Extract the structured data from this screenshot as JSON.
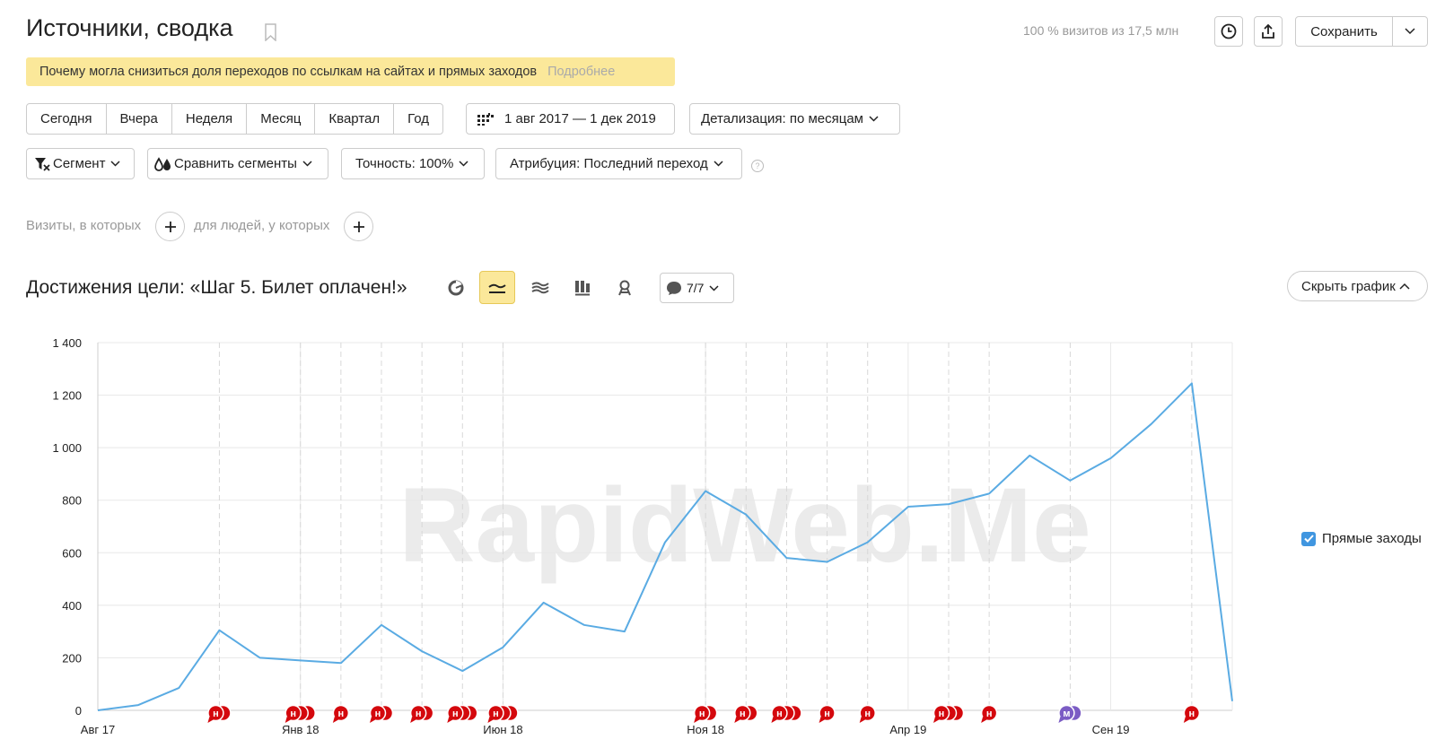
{
  "header": {
    "title": "Источники, сводка",
    "visits_info": "100 % визитов из 17,5 млн",
    "save_label": "Сохранить"
  },
  "notice": {
    "text": "Почему могла снизиться доля переходов по ссылкам на сайтах и прямых заходов",
    "more": "Подробнее"
  },
  "period": {
    "buttons": [
      "Сегодня",
      "Вчера",
      "Неделя",
      "Месяц",
      "Квартал",
      "Год"
    ],
    "date_range": "1 авг 2017 — 1 дек 2019",
    "detail": "Детализация: по месяцам"
  },
  "filters": {
    "segment": "Сегмент",
    "compare": "Сравнить сегменты",
    "accuracy": "Точность: 100%",
    "attribution": "Атрибуция: Последний переход",
    "help": "?",
    "visits_label": "Визиты, в которых",
    "people_label": "для людей, у которых"
  },
  "chart_header": {
    "title": "Достижения цели: «Шаг 5. Билет оплачен!»",
    "notes_count": "7/7",
    "hide_chart": "Скрыть график",
    "selected_type": "line"
  },
  "legend": {
    "item": "Прямые заходы",
    "checked": true,
    "color": "#5aabe3"
  },
  "watermark": "RapidWeb.Me",
  "chart_data": {
    "type": "line",
    "series": [
      {
        "name": "Прямые заходы",
        "color": "#5aabe3",
        "values": [
          0,
          20,
          85,
          305,
          200,
          190,
          180,
          325,
          225,
          150,
          240,
          410,
          325,
          300,
          640,
          835,
          745,
          580,
          565,
          640,
          775,
          785,
          825,
          970,
          875,
          960,
          1090,
          1245,
          35
        ]
      }
    ],
    "x_tick_labels": [
      {
        "index": 0,
        "label": "Авг 17"
      },
      {
        "index": 5,
        "label": "Янв 18"
      },
      {
        "index": 10,
        "label": "Июн 18"
      },
      {
        "index": 15,
        "label": "Ноя 18"
      },
      {
        "index": 20,
        "label": "Апр 19"
      },
      {
        "index": 25,
        "label": "Сен 19"
      }
    ],
    "y_ticks": [
      "0",
      "200",
      "400",
      "600",
      "800",
      "1 000",
      "1 200",
      "1 400"
    ],
    "ylim": [
      0,
      1400
    ],
    "grid": true,
    "note_markers": [
      {
        "index": 3,
        "count": 2,
        "letter": "н",
        "color": "#d4080d"
      },
      {
        "index": 5,
        "count": 3,
        "letter": "н",
        "color": "#d4080d"
      },
      {
        "index": 6,
        "count": 1,
        "letter": "н",
        "color": "#d4080d"
      },
      {
        "index": 7,
        "count": 2,
        "letter": "н",
        "color": "#d4080d"
      },
      {
        "index": 8,
        "count": 2,
        "letter": "н",
        "color": "#d4080d"
      },
      {
        "index": 9,
        "count": 3,
        "letter": "н",
        "color": "#d4080d"
      },
      {
        "index": 10,
        "count": 3,
        "letter": "н",
        "color": "#d4080d"
      },
      {
        "index": 15,
        "count": 2,
        "letter": "н",
        "color": "#d4080d"
      },
      {
        "index": 16,
        "count": 2,
        "letter": "н",
        "color": "#d4080d"
      },
      {
        "index": 17,
        "count": 3,
        "letter": "н",
        "color": "#d4080d"
      },
      {
        "index": 18,
        "count": 1,
        "letter": "н",
        "color": "#d4080d"
      },
      {
        "index": 19,
        "count": 1,
        "letter": "н",
        "color": "#d4080d"
      },
      {
        "index": 21,
        "count": 3,
        "letter": "н",
        "color": "#d4080d"
      },
      {
        "index": 22,
        "count": 1,
        "letter": "н",
        "color": "#d4080d"
      },
      {
        "index": 24,
        "count": 2,
        "letter": "м",
        "color": "#7b5cc4"
      },
      {
        "index": 27,
        "count": 1,
        "letter": "н",
        "color": "#d4080d"
      }
    ]
  }
}
